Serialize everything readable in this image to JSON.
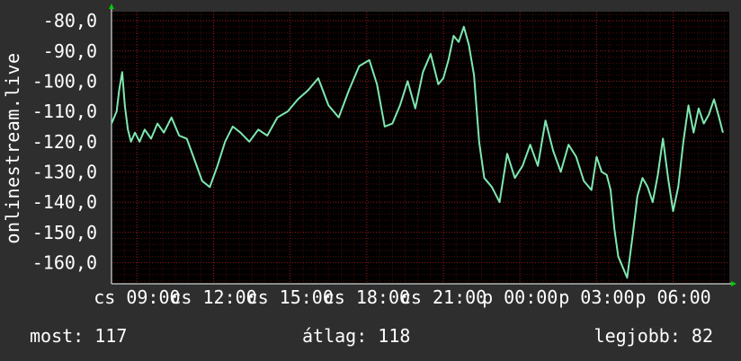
{
  "chart_data": {
    "type": "line",
    "ylabel": "onlinestream.live",
    "ylim": [
      -167,
      -77
    ],
    "yticks": [
      -80,
      -90,
      -100,
      -110,
      -120,
      -130,
      -140,
      -150,
      -160
    ],
    "ytick_labels": [
      "-80,0",
      "-90,0",
      "-100,0",
      "-110,0",
      "-120,0",
      "-130,0",
      "-140,0",
      "-150,0",
      "-160,0"
    ],
    "xlim": [
      8.0,
      32.2
    ],
    "xticks": [
      9,
      12,
      15,
      18,
      21,
      24,
      27,
      30
    ],
    "xtick_labels": [
      "cs 09:00",
      "cs 12:00",
      "cs 15:00",
      "cs 18:00",
      "cs 21:00",
      "p 00:00",
      "p 03:00",
      "p 06:00"
    ],
    "grid": true,
    "series": [
      {
        "color": "#7ee8b0",
        "x": [
          8.0,
          8.2,
          8.3,
          8.42,
          8.52,
          8.64,
          8.76,
          8.92,
          9.1,
          9.3,
          9.55,
          9.8,
          10.05,
          10.35,
          10.65,
          10.95,
          11.25,
          11.55,
          11.85,
          12.15,
          12.45,
          12.75,
          13.05,
          13.4,
          13.75,
          14.1,
          14.5,
          14.9,
          15.3,
          15.7,
          16.1,
          16.5,
          16.9,
          17.3,
          17.7,
          18.1,
          18.4,
          18.7,
          19.0,
          19.3,
          19.6,
          19.9,
          20.2,
          20.5,
          20.8,
          21.0,
          21.2,
          21.4,
          21.6,
          21.8,
          22.0,
          22.2,
          22.4,
          22.6,
          22.9,
          23.2,
          23.5,
          23.8,
          24.1,
          24.4,
          24.7,
          25.0,
          25.3,
          25.6,
          25.9,
          26.2,
          26.5,
          26.8,
          27.0,
          27.2,
          27.4,
          27.55,
          27.7,
          27.85,
          28.0,
          28.2,
          28.4,
          28.6,
          28.8,
          29.0,
          29.2,
          29.4,
          29.6,
          29.8,
          30.0,
          30.2,
          30.4,
          30.6,
          30.8,
          31.0,
          31.2,
          31.4,
          31.6,
          31.8,
          31.95
        ],
        "y": [
          -114,
          -110,
          -103,
          -97,
          -108,
          -116,
          -120,
          -117,
          -120,
          -116,
          -119,
          -114,
          -117,
          -112,
          -118,
          -119,
          -126,
          -133,
          -135,
          -128,
          -120,
          -115,
          -117,
          -120,
          -116,
          -118,
          -112,
          -110,
          -106,
          -103,
          -99,
          -108,
          -112,
          -103,
          -95,
          -93,
          -101,
          -115,
          -114,
          -108,
          -100,
          -109,
          -97,
          -91,
          -101,
          -99,
          -93,
          -85,
          -87,
          -82,
          -88,
          -98,
          -120,
          -132,
          -135,
          -140,
          -124,
          -132,
          -128,
          -121,
          -128,
          -113,
          -123,
          -130,
          -121,
          -125,
          -133,
          -136,
          -125,
          -130,
          -131,
          -136,
          -149,
          -158,
          -161,
          -165,
          -152,
          -138,
          -132,
          -135,
          -140,
          -131,
          -119,
          -132,
          -143,
          -135,
          -120,
          -108,
          -117,
          -109,
          -114,
          -111,
          -106,
          -112,
          -117
        ]
      }
    ],
    "colors": {
      "background": "#2e2e2e",
      "plot_background": "#000000",
      "grid": "#b01e1e",
      "axis": "#ffffff",
      "arrow": "#00cc00",
      "text": "#ffffff"
    }
  },
  "stats": {
    "current": "most: 117",
    "average": "átlag: 118",
    "best": "legjobb: 82"
  }
}
